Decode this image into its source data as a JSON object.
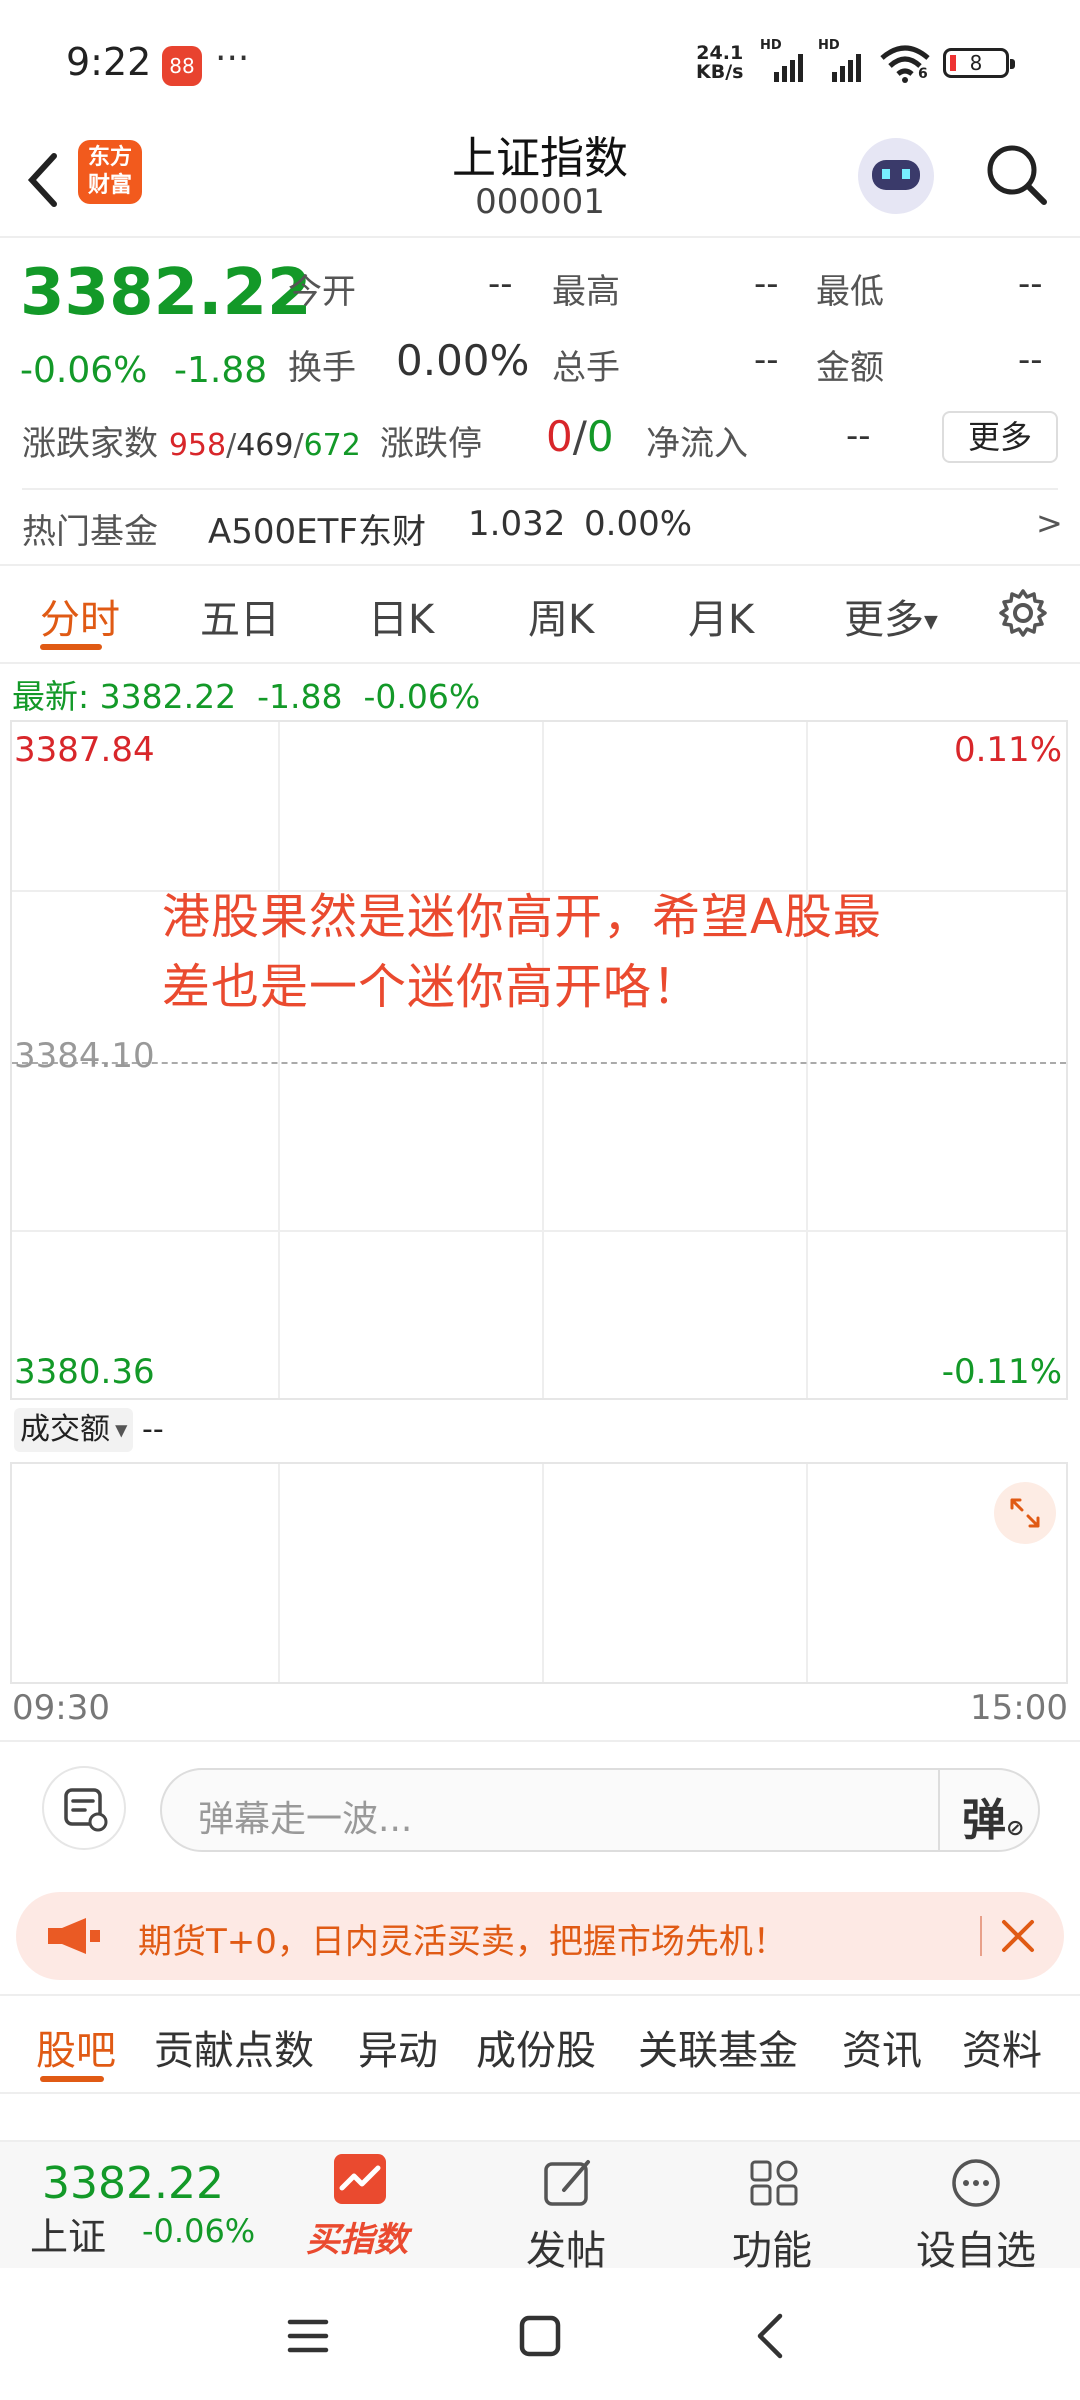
{
  "status_bar": {
    "time": "9:22",
    "app_icon_text": "88",
    "more": "···",
    "net_speed_value": "24.1",
    "net_speed_unit": "KB/s",
    "hd1": "HD",
    "hd2": "HD",
    "wifi_badge": "6",
    "battery": "8"
  },
  "header": {
    "back_icon": "chevron-left-icon",
    "logo_line1": "东方",
    "logo_line2": "财富",
    "title": "上证指数",
    "code": "000001",
    "robot_icon": "robot-avatar-icon",
    "search_icon": "search-icon"
  },
  "quote": {
    "price": "3382.22",
    "change_pct": "-0.06%",
    "change": "-1.88",
    "open_label": "今开",
    "open_value": "--",
    "high_label": "最高",
    "high_value": "--",
    "low_label": "最低",
    "low_value": "--",
    "turnover_label": "换手",
    "turnover_value": "0.00%",
    "volume_label": "总手",
    "volume_value": "--",
    "amount_label": "金额",
    "amount_value": "--",
    "updown_label": "涨跌家数",
    "up_count": "958",
    "flat_count": "469",
    "down_count": "672",
    "limit_label": "涨跌停",
    "limit_up": "0",
    "limit_down": "0",
    "netflow_label": "净流入",
    "netflow_value": "--",
    "more_button": "更多"
  },
  "hot_fund": {
    "label": "热门基金",
    "name": "A500ETF东财",
    "price": "1.032",
    "pct": "0.00%",
    "arrow": ">"
  },
  "chart_tabs": [
    "分时",
    "五日",
    "日K",
    "周K",
    "月K",
    "更多"
  ],
  "chart": {
    "latest_label": "最新:",
    "latest_price": "3382.22",
    "latest_change": "-1.88",
    "latest_pct": "-0.06%",
    "y_top": "3387.84",
    "y_mid": "3384.10",
    "y_bottom": "3380.36",
    "pct_top": "0.11%",
    "pct_bottom": "-0.11%",
    "danmaku_line1": "港股果然是迷你高开，希望A股最",
    "danmaku_line2": "差也是一个迷你高开咯！",
    "volume_selector": "成交额",
    "volume_value": "--",
    "time_start": "09:30",
    "time_end": "15:00"
  },
  "chart_data": {
    "type": "line",
    "title": "",
    "xlabel": "",
    "ylabel": "",
    "x": [],
    "series": [],
    "ylim": [
      3380.36,
      3387.84
    ],
    "pre_close": 3384.1,
    "x_range": [
      "09:30",
      "15:00"
    ]
  },
  "comment_bar": {
    "placeholder": "弹幕走一波...",
    "danmaku_toggle": "弹"
  },
  "ad": {
    "text": "期货T+0，日内灵活买卖，把握市场先机！"
  },
  "bottom_tabs": [
    "股吧",
    "贡献点数",
    "异动",
    "成份股",
    "关联基金",
    "资讯",
    "资料"
  ],
  "footer": {
    "price": "3382.22",
    "name": "上证",
    "pct": "-0.06%",
    "buy_label": "买指数",
    "post_label": "发帖",
    "func_label": "功能",
    "watch_label": "设自选"
  },
  "colors": {
    "up": "#d8262a",
    "down": "#139928",
    "accent": "#e05a14"
  }
}
